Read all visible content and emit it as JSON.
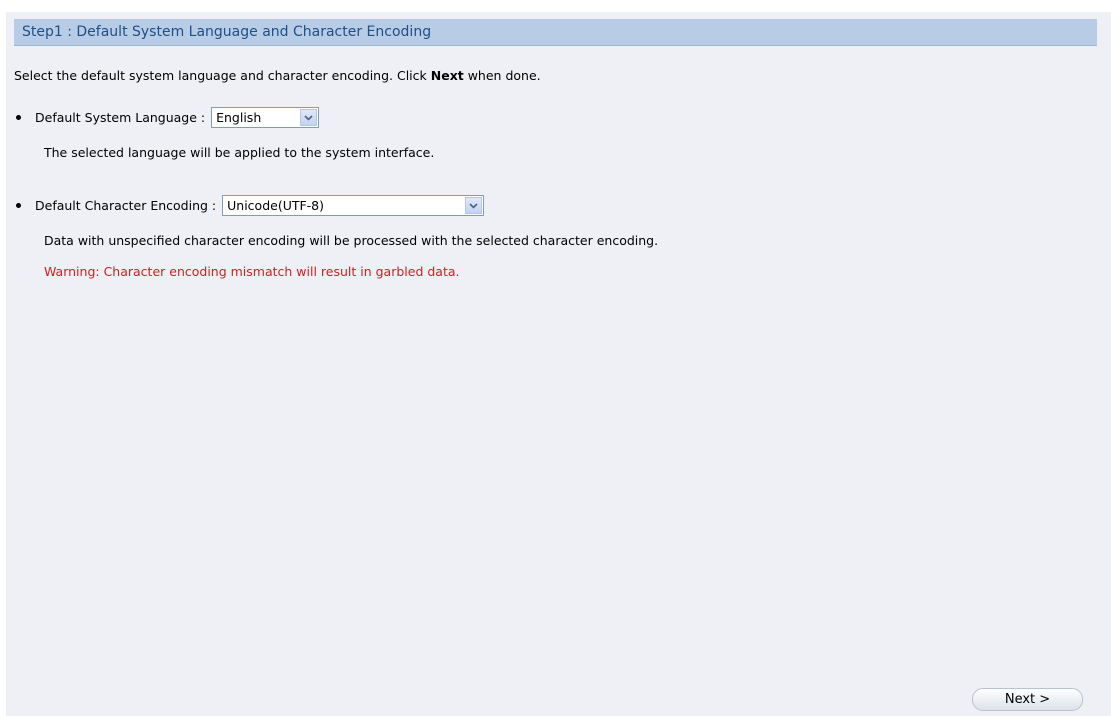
{
  "header": {
    "title": "Step1 : Default System Language and Character Encoding"
  },
  "intro": {
    "prefix": "Select the default system language and character encoding. Click ",
    "bold": "Next",
    "suffix": " when done."
  },
  "language": {
    "label": "Default System Language :",
    "selected": "English",
    "description": "The selected language will be applied to the system interface."
  },
  "encoding": {
    "label": "Default Character Encoding :",
    "selected": "Unicode(UTF-8)",
    "description": "Data with unspecified character encoding will be processed with the selected character encoding.",
    "warning": "Warning: Character encoding mismatch will result in garbled data."
  },
  "footer": {
    "next_label": "Next >"
  },
  "icons": {
    "dropdown": "chevron-down-icon",
    "bullet": "bullet-icon"
  },
  "colors": {
    "header_bg": "#b9cce6",
    "header_text": "#1d4f8a",
    "warning": "#d31d1d",
    "page_bg": "#eef0f5"
  }
}
